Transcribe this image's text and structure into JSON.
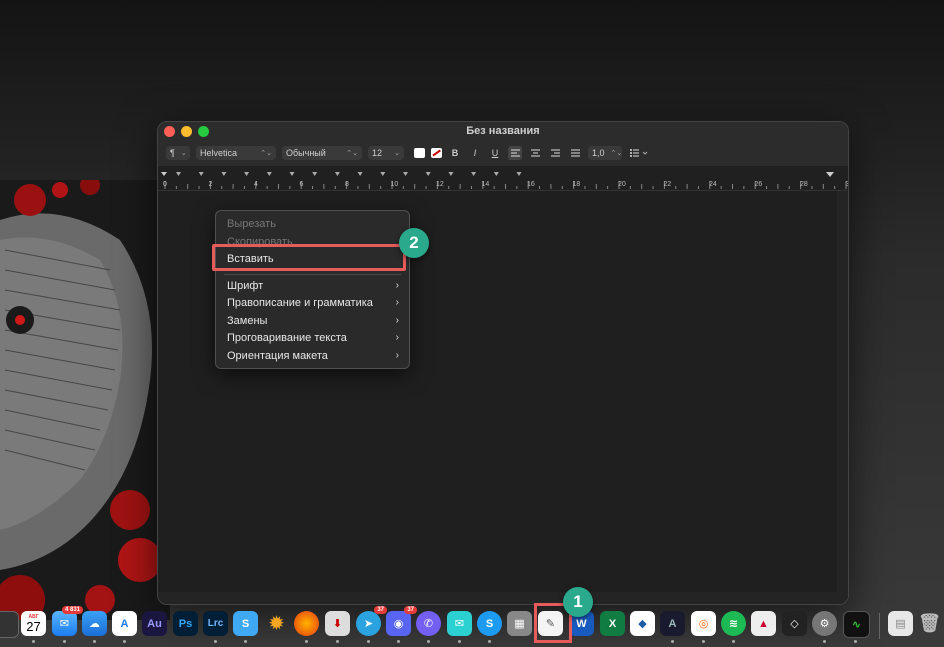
{
  "window": {
    "title": "Без названия",
    "toolbar": {
      "paragraph_style_icon": "¶",
      "font_family": "Helvetica",
      "font_style": "Обычный",
      "font_size": "12",
      "bold": "B",
      "italic": "I",
      "underline": "U",
      "line_spacing": "1,0"
    },
    "ruler_numbers": [
      "0",
      "2",
      "4",
      "6",
      "8",
      "10",
      "12",
      "14",
      "16",
      "18",
      "20",
      "22",
      "24",
      "26",
      "28",
      "3"
    ]
  },
  "context_menu": {
    "items": [
      {
        "label": "Вырезать",
        "disabled": true
      },
      {
        "label": "Скопировать",
        "disabled": true
      },
      {
        "label": "Вставить",
        "disabled": false
      },
      {
        "label": "Шрифт",
        "submenu": true
      },
      {
        "label": "Правописание и грамматика",
        "submenu": true
      },
      {
        "label": "Замены",
        "submenu": true
      },
      {
        "label": "Проговаривание текста",
        "submenu": true
      },
      {
        "label": "Ориентация макета",
        "submenu": true
      }
    ]
  },
  "annotations": {
    "step1": "1",
    "step2": "2",
    "accent_color": "#2aa98d",
    "highlight_color": "#e85b5b"
  },
  "dock": {
    "calendar_month": "АВГ",
    "calendar_day": "27",
    "mail_badge": "4 831",
    "telegram_badge": "37",
    "discord_badge": "37",
    "audition_label": "Au",
    "photoshop_label": "Ps",
    "lightroom_label": "Lrc",
    "word_label": "W"
  }
}
